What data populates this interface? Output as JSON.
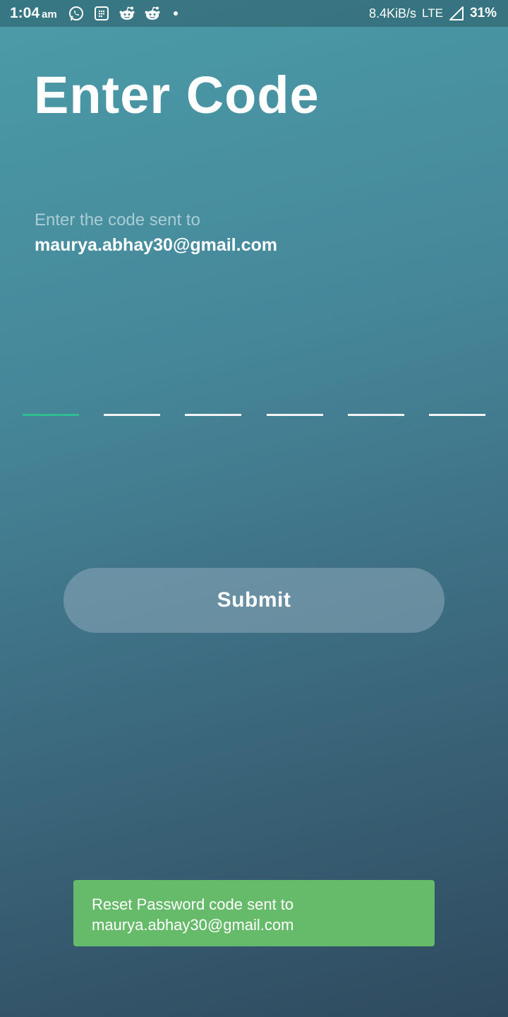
{
  "status_bar": {
    "time": "1:04",
    "ampm": "am",
    "notification_icons": [
      "whatsapp-icon",
      "calculator-icon",
      "reddit-icon",
      "reddit-icon"
    ],
    "network_speed": "8.4KiB/s",
    "network_type": "LTE",
    "battery": "31%"
  },
  "page": {
    "title": "Enter Code",
    "subtitle": "Enter the code sent to",
    "email": "maurya.abhay30@gmail.com"
  },
  "code_input": {
    "slots": 6,
    "active_slot": 1,
    "active_color": "#2fbf8f",
    "inactive_color": "#f2f5f6"
  },
  "submit": {
    "label": "Submit"
  },
  "toast": {
    "line1": "Reset Password code sent to",
    "line2": "maurya.abhay30@gmail.com",
    "color": "#66bb6a"
  },
  "theme": {
    "gradient_top": "#4a9ca9",
    "gradient_bottom": "#2f4a5e"
  }
}
